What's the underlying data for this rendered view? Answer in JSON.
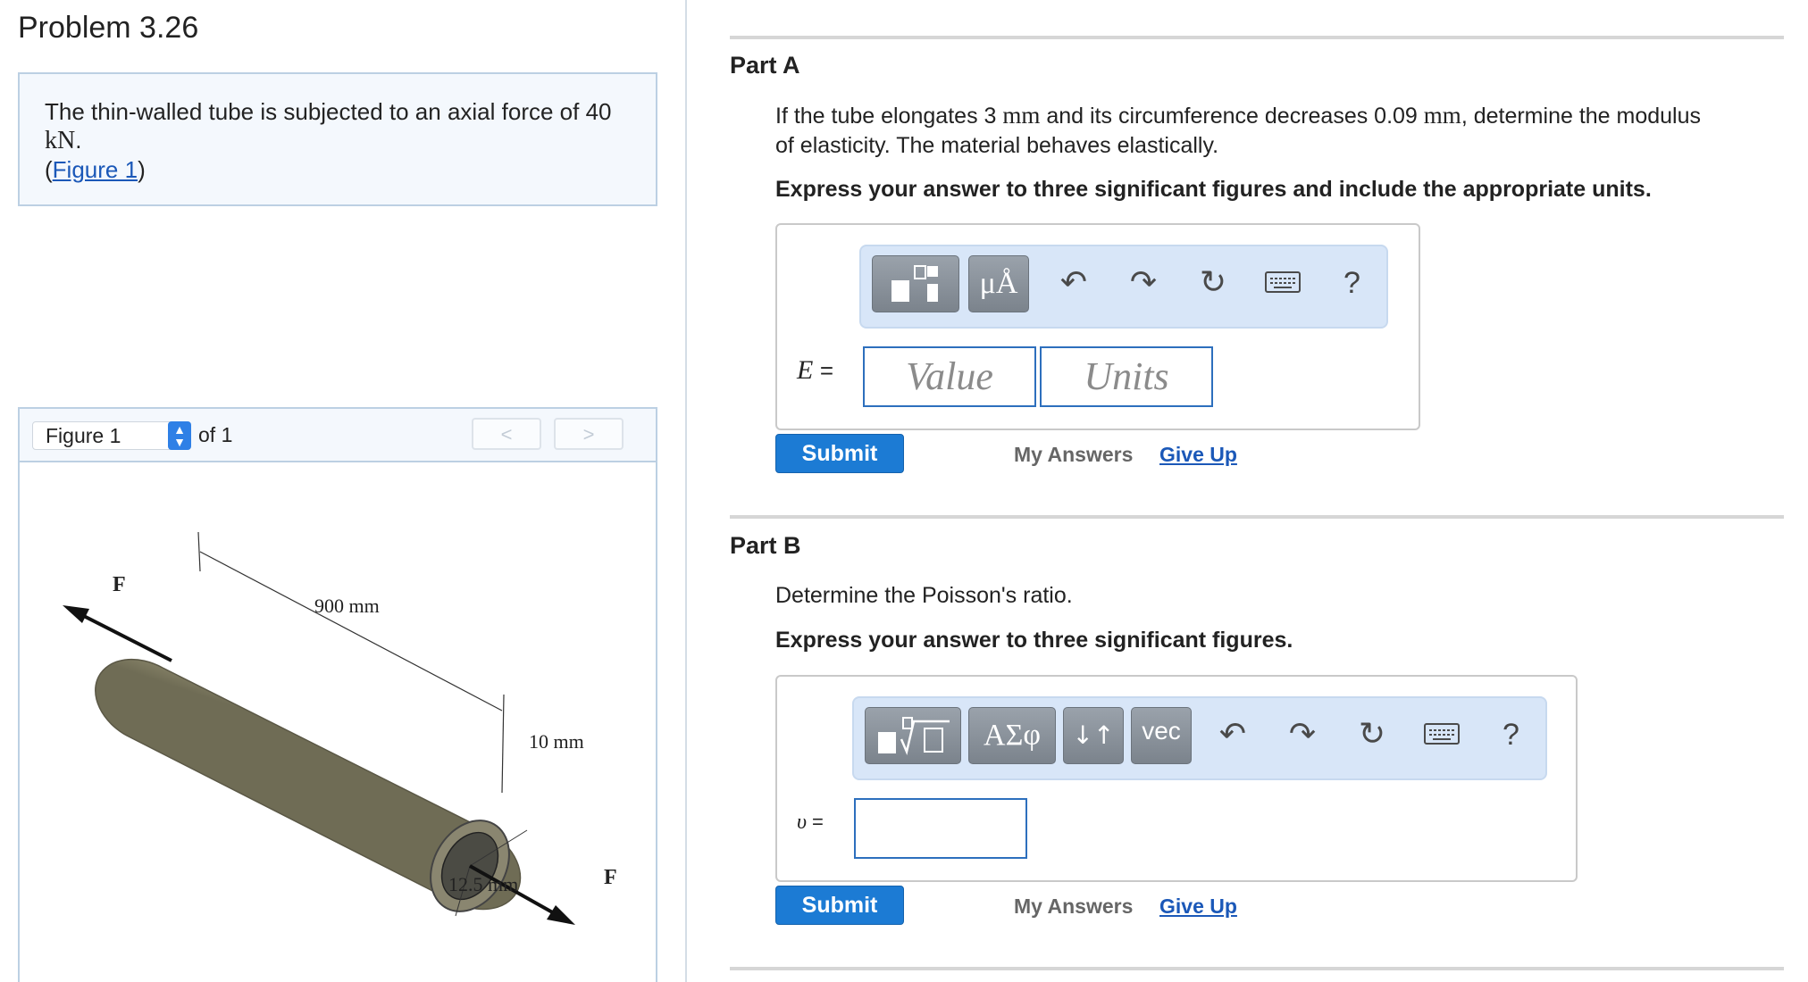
{
  "problem": {
    "title": "Problem 3.26",
    "statement": "The thin-walled tube is subjected to an axial force of 40",
    "statement_unit": "kN",
    "statement_end": ".",
    "figure_link_open": "(",
    "figure_link": "Figure 1",
    "figure_link_close": ")"
  },
  "figure_panel": {
    "select_value": "Figure 1",
    "of_label": "of 1",
    "prev_label": "<",
    "next_label": ">",
    "labels": {
      "force_left": "F",
      "force_right": "F",
      "length": "900 mm",
      "inner": "10 mm",
      "outer": "12.5 mm"
    }
  },
  "part_a": {
    "title": "Part A",
    "question_pre": "If the tube elongates 3",
    "unit1": "mm",
    "question_mid": "and its circumference decreases 0.09",
    "unit2": "mm",
    "question_post": ", determine the modulus",
    "question_line2": "of elasticity. The material behaves elastically.",
    "instruction": "Express your answer to three significant figures and include the appropriate units.",
    "toolbar": {
      "units_button": "μÅ",
      "icons": [
        "templates-icon",
        "units-icon",
        "undo-icon",
        "redo-icon",
        "reset-icon",
        "keyboard-icon",
        "help-icon"
      ],
      "help_label": "?"
    },
    "variable": "E",
    "equals": "=",
    "value_placeholder": "Value",
    "units_placeholder": "Units",
    "submit": "Submit",
    "my_answers": "My Answers",
    "give_up": "Give Up"
  },
  "part_b": {
    "title": "Part B",
    "question": "Determine the Poisson's ratio.",
    "instruction": "Express your answer to three significant figures.",
    "toolbar": {
      "greek_button": "ΑΣφ",
      "arrows_button": "↓↑",
      "vec_button": "vec",
      "icons": [
        "templates-icon",
        "greek-icon",
        "subscript-icon",
        "vector-icon",
        "undo-icon",
        "redo-icon",
        "reset-icon",
        "keyboard-icon",
        "help-icon"
      ],
      "help_label": "?"
    },
    "variable": "υ",
    "equals": "=",
    "submit": "Submit",
    "my_answers": "My Answers",
    "give_up": "Give Up"
  },
  "colors": {
    "link": "#1b58b8",
    "submit": "#1c7bd4",
    "toolbar_bg": "#d8e6f8",
    "panel_bg": "#f4f8fd"
  }
}
